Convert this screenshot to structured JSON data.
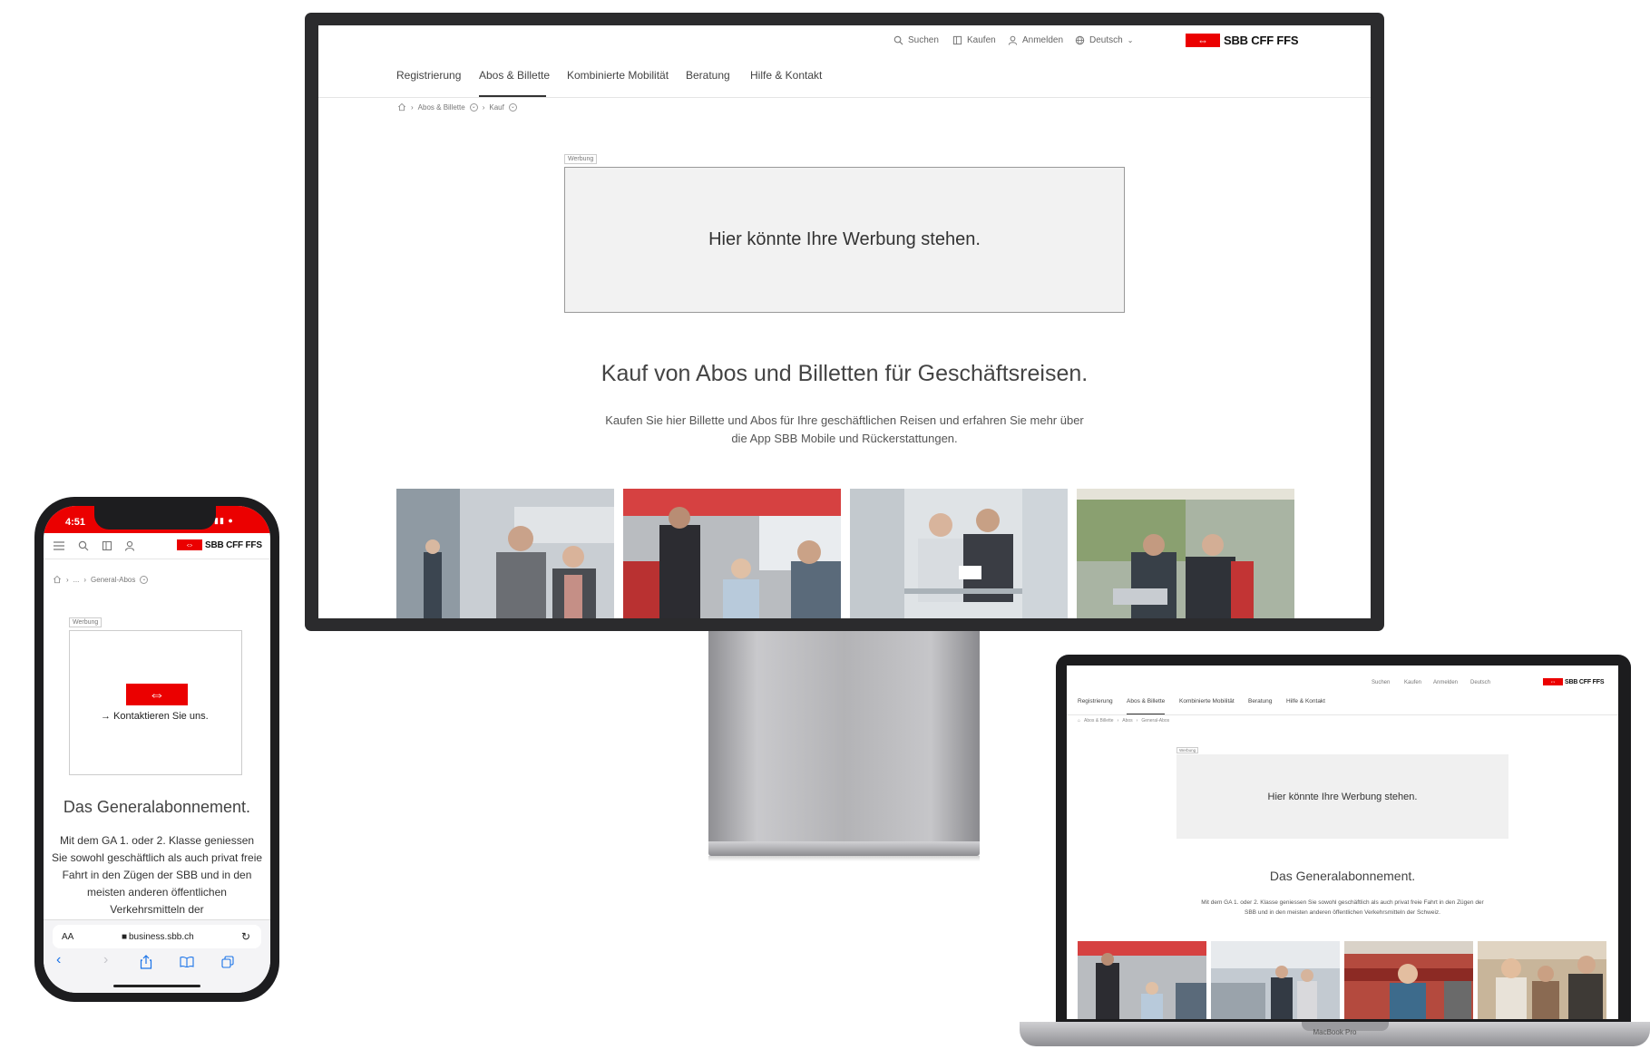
{
  "brand": {
    "logo_text": "SBB CFF FFS",
    "logo_symbol": "⇔",
    "accent": "#eb0000"
  },
  "desktop": {
    "utility": [
      {
        "icon": "search-icon",
        "label": "Suchen"
      },
      {
        "icon": "ticket-icon",
        "label": "Kaufen"
      },
      {
        "icon": "user-icon",
        "label": "Anmelden"
      },
      {
        "icon": "globe-icon",
        "label": "Deutsch"
      }
    ],
    "nav": [
      "Registrierung",
      "Abos & Billette",
      "Kombinierte Mobilität",
      "Beratung",
      "Hilfe & Kontakt"
    ],
    "active_nav": "Abos & Billette",
    "breadcrumb": [
      "Abos & Billette",
      "Kauf"
    ],
    "ad_tag": "Werbung",
    "ad_text": "Hier könnte Ihre Werbung stehen.",
    "heading": "Kauf von Abos und Billetten für Geschäftsreisen.",
    "lead": "Kaufen Sie hier Billette und Abos für Ihre geschäftlichen Reisen und erfahren Sie mehr über die App SBB Mobile und Rückerstattungen."
  },
  "phone": {
    "time": "4:51",
    "breadcrumb": [
      "...",
      "General-Abos"
    ],
    "ad_tag": "Werbung",
    "ad_link": "Kontaktieren Sie uns.",
    "heading": "Das Generalabonnement.",
    "body": "Mit dem GA 1. oder 2. Klasse geniessen Sie sowohl geschäftlich als auch privat freie Fahrt in den Zügen der SBB und in den meisten anderen öffentlichen Verkehrsmitteln der",
    "address_aa": "AA",
    "url": "business.sbb.ch"
  },
  "laptop": {
    "utility": [
      "Suchen",
      "Kaufen",
      "Anmelden",
      "Deutsch"
    ],
    "nav": [
      "Registrierung",
      "Abos & Billette",
      "Kombinierte Mobilität",
      "Beratung",
      "Hilfe & Kontakt"
    ],
    "breadcrumb": [
      "Abos & Billette",
      "Abos",
      "General-Abos"
    ],
    "ad_tag": "Werbung",
    "ad_text": "Hier könnte Ihre Werbung stehen.",
    "heading": "Das Generalabonnement.",
    "lead": "Mit dem GA 1. oder 2. Klasse geniessen Sie sowohl geschäftlich als auch privat freie Fahrt in den Zügen der SBB und in den meisten anderen öffentlichen Verkehrsmitteln der Schweiz.",
    "model_label": "MacBook Pro"
  }
}
